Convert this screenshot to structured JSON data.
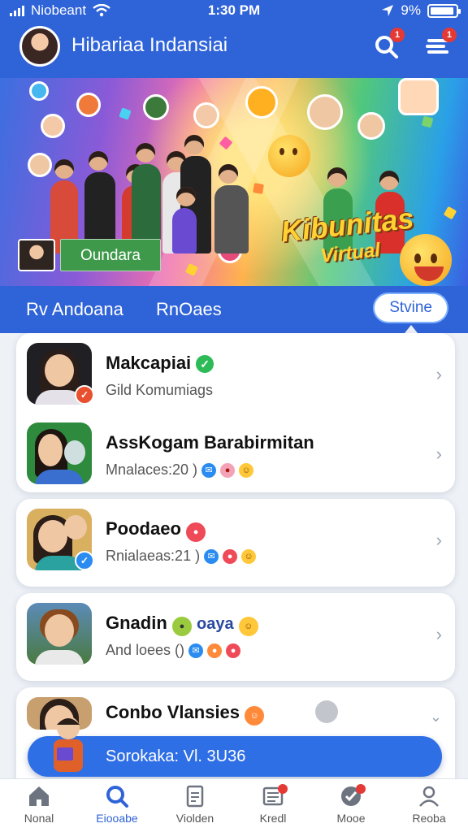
{
  "status_bar": {
    "carrier": "Niobeant",
    "time": "1:30 PM",
    "battery_text": "9%"
  },
  "header": {
    "title": "Hibariaa Indansiai",
    "search_badge": "1",
    "menu_badge": "1"
  },
  "banner": {
    "headline_line1": "Kibunitas",
    "headline_line2": "Virtual",
    "chip_label": "Oundara"
  },
  "tabs": {
    "tab1": "Rv Andoana",
    "tab2": "RnOaes",
    "tab3_active": "Stvine"
  },
  "list": [
    {
      "name": "Makcapiai",
      "subtitle": "Gild Komumiags",
      "verified": true,
      "badge_color": "#e8512f"
    },
    {
      "name": "AssKogam Barabirmitan",
      "subtitle": "Mnalaces:20  )"
    },
    {
      "name": "Poodaeo",
      "subtitle": "Rnialaeas:21  )",
      "badge_color": "#2a8cf0"
    },
    {
      "name": "Gnadin",
      "name_suffix": "oaya",
      "subtitle": "And loees  ()"
    },
    {
      "name": "Conbo Vlansies"
    }
  ],
  "toast": {
    "text": "Sorokaka: Vl. 3U36"
  },
  "bottom_nav": [
    {
      "label": "Nonal",
      "icon": "home-icon"
    },
    {
      "label": "Eiooabe",
      "icon": "search-icon",
      "active": true
    },
    {
      "label": "Violden",
      "icon": "document-icon"
    },
    {
      "label": "Kredl",
      "icon": "inbox-icon"
    },
    {
      "label": "Mooe",
      "icon": "heart-icon"
    },
    {
      "label": "Reoba",
      "icon": "profile-icon"
    }
  ],
  "colors": {
    "primary": "#2f63d8",
    "verified": "#2dbb57",
    "alert": "#e53935"
  }
}
